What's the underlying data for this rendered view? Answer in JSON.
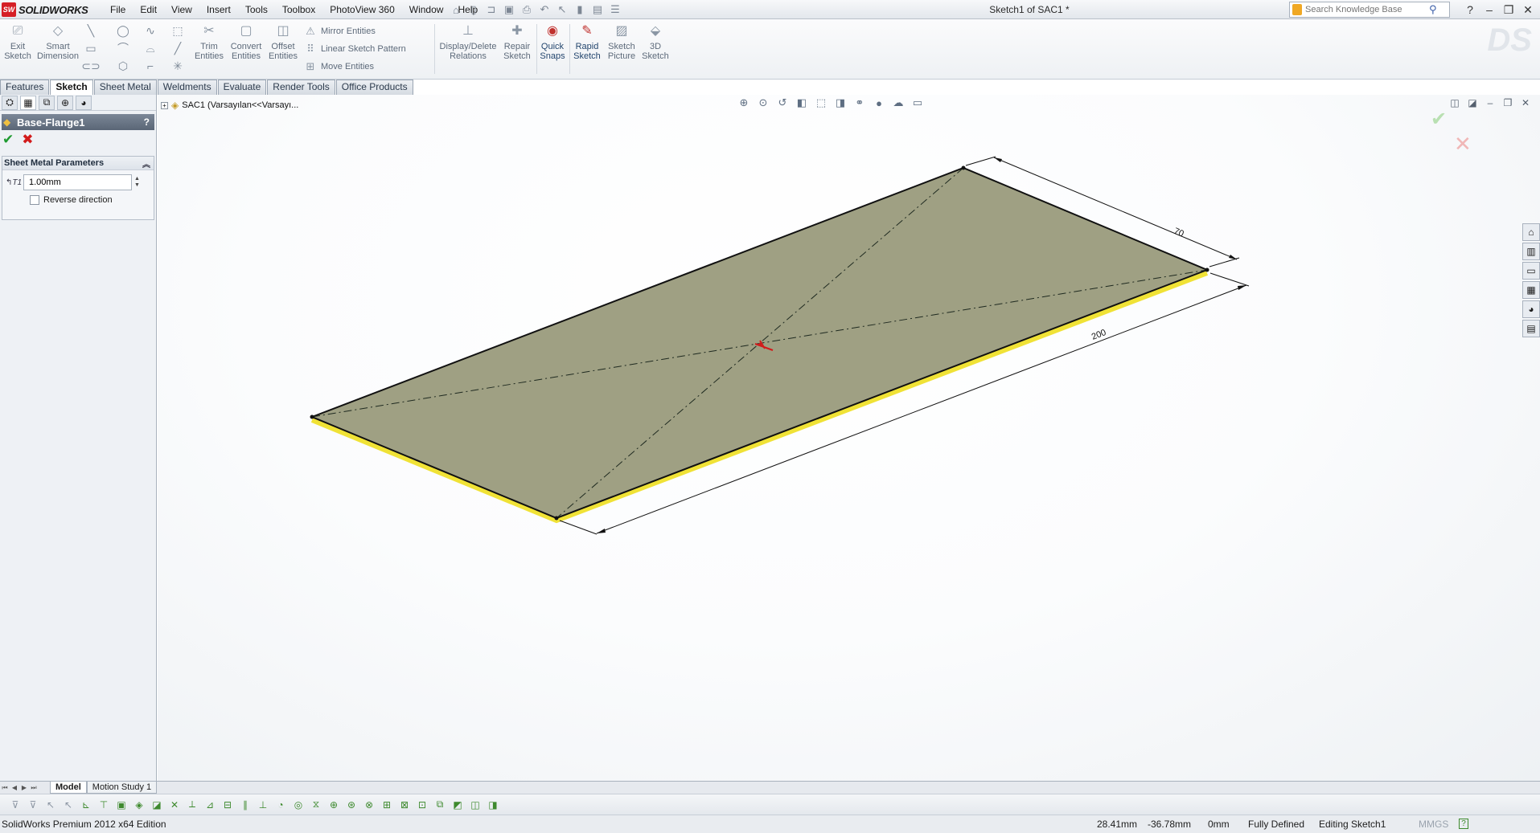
{
  "app": {
    "brand": "SOLIDWORKS",
    "brand_badge": "SW",
    "doc_title": "Sketch1 of SAC1 *",
    "menus": [
      "File",
      "Edit",
      "View",
      "Insert",
      "Tools",
      "Toolbox",
      "PhotoView 360",
      "Window",
      "Help"
    ]
  },
  "search": {
    "placeholder": "Search Knowledge Base"
  },
  "toolbar": {
    "exit_sketch": "Exit\nSketch",
    "smart_dimension": "Smart\nDimension",
    "trim_entities": "Trim\nEntities",
    "convert_entities": "Convert\nEntities",
    "offset_entities": "Offset\nEntities",
    "mirror_entities": "Mirror Entities",
    "linear_sketch_pattern": "Linear Sketch Pattern",
    "move_entities": "Move Entities",
    "display_delete_relations": "Display/Delete\nRelations",
    "repair_sketch": "Repair\nSketch",
    "quick_snaps": "Quick\nSnaps",
    "rapid_sketch": "Rapid\nSketch",
    "sketch_picture": "Sketch\nPicture",
    "sketch_3d": "3D\nSketch"
  },
  "tabs": [
    {
      "label": "Features",
      "active": false
    },
    {
      "label": "Sketch",
      "active": true
    },
    {
      "label": "Sheet Metal",
      "active": false
    },
    {
      "label": "Weldments",
      "active": false
    },
    {
      "label": "Evaluate",
      "active": false
    },
    {
      "label": "Render Tools",
      "active": false
    },
    {
      "label": "Office Products",
      "active": false
    }
  ],
  "property_manager": {
    "title": "Base-Flange1",
    "help": "?",
    "group_title": "Sheet Metal Parameters",
    "thickness_value": "1.00mm",
    "reverse_direction_label": "Reverse direction",
    "reverse_direction_checked": false
  },
  "tree": {
    "root_label": "SAC1  (Varsayılan<<Varsayı..."
  },
  "dimensions": {
    "width": "70",
    "length": "200"
  },
  "colors": {
    "face": "#9a9b7c",
    "edge_highlight": "#f0e236",
    "accent_red": "#d21b1b",
    "ok_green": "#1f9b31"
  },
  "bottom_tabs": [
    {
      "label": "Model",
      "active": true
    },
    {
      "label": "Motion Study 1",
      "active": false
    }
  ],
  "status": {
    "edition": "SolidWorks Premium 2012 x64 Edition",
    "x": "28.41mm",
    "y": "-36.78mm",
    "z": "0mm",
    "state": "Fully Defined",
    "mode": "Editing Sketch1",
    "units": "MMGS"
  }
}
